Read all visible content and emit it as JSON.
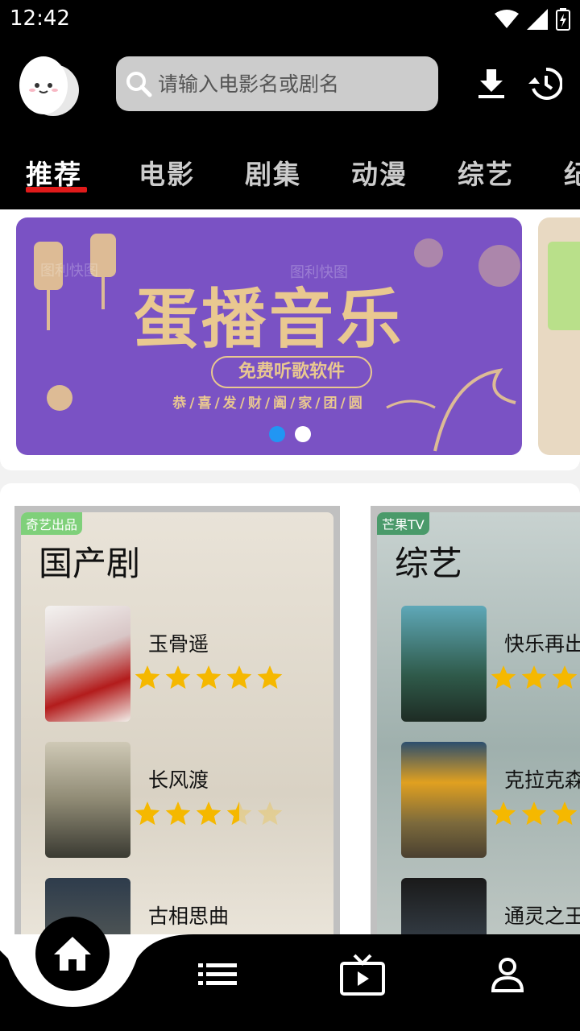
{
  "status_bar": {
    "time": "12:42"
  },
  "search": {
    "placeholder": "请输入电影名或剧名"
  },
  "tabs": [
    {
      "label": "推荐",
      "active": true
    },
    {
      "label": "电影"
    },
    {
      "label": "剧集"
    },
    {
      "label": "动漫"
    },
    {
      "label": "综艺"
    },
    {
      "label": "纪"
    }
  ],
  "banner": {
    "title": "蛋播音乐",
    "pill": "免费听歌软件",
    "subtitle": "恭/喜/发/财/阖/家/团/圆",
    "watermark1": "图利快图",
    "watermark2": "图利快图",
    "slides": 2,
    "active_slide": 0
  },
  "categories": [
    {
      "title": "国产剧",
      "badge": "奇艺出品",
      "items": [
        {
          "name": "玉骨遥",
          "rating": 5
        },
        {
          "name": "长风渡",
          "rating": 3.5
        },
        {
          "name": "古相思曲",
          "rating": 0
        }
      ]
    },
    {
      "title": "综艺",
      "badge": "芒果TV",
      "items": [
        {
          "name": "快乐再出",
          "rating": 3
        },
        {
          "name": "克拉克森",
          "rating": 3
        },
        {
          "name": "通灵之王",
          "rating": 0
        }
      ]
    }
  ],
  "colors": {
    "accent_underline": "#e01a1a",
    "dot_active": "#2196f3",
    "star": "#f5b800",
    "banner_bg": "#7a52c4"
  },
  "bottom_nav": [
    "home-icon",
    "list-icon",
    "tv-icon",
    "profile-icon"
  ]
}
